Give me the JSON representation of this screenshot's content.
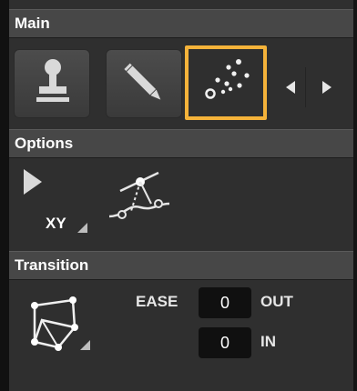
{
  "sections": {
    "main": {
      "title": "Main",
      "tabs": [
        {
          "icon": "stamp-icon",
          "active": false
        },
        {
          "icon": "pencil-icon",
          "active": false
        },
        {
          "icon": "scatter-points-icon",
          "active": true
        }
      ],
      "nav": {
        "prev_icon": "chevron-left-icon",
        "next_icon": "chevron-right-icon"
      }
    },
    "options": {
      "title": "Options",
      "pointer_icon": "pointer-arrow-icon",
      "xy_label": "XY",
      "curve_icon": "bezier-curve-icon"
    },
    "transition": {
      "title": "Transition",
      "shape_icon": "polygon-nodes-icon",
      "ease_label": "EASE",
      "out_value": "0",
      "out_label": "OUT",
      "in_value": "0",
      "in_label": "IN"
    }
  },
  "colors": {
    "accent": "#f5b33a",
    "panel": "#2f2f2f",
    "header": "#474747",
    "field": "#101010"
  }
}
